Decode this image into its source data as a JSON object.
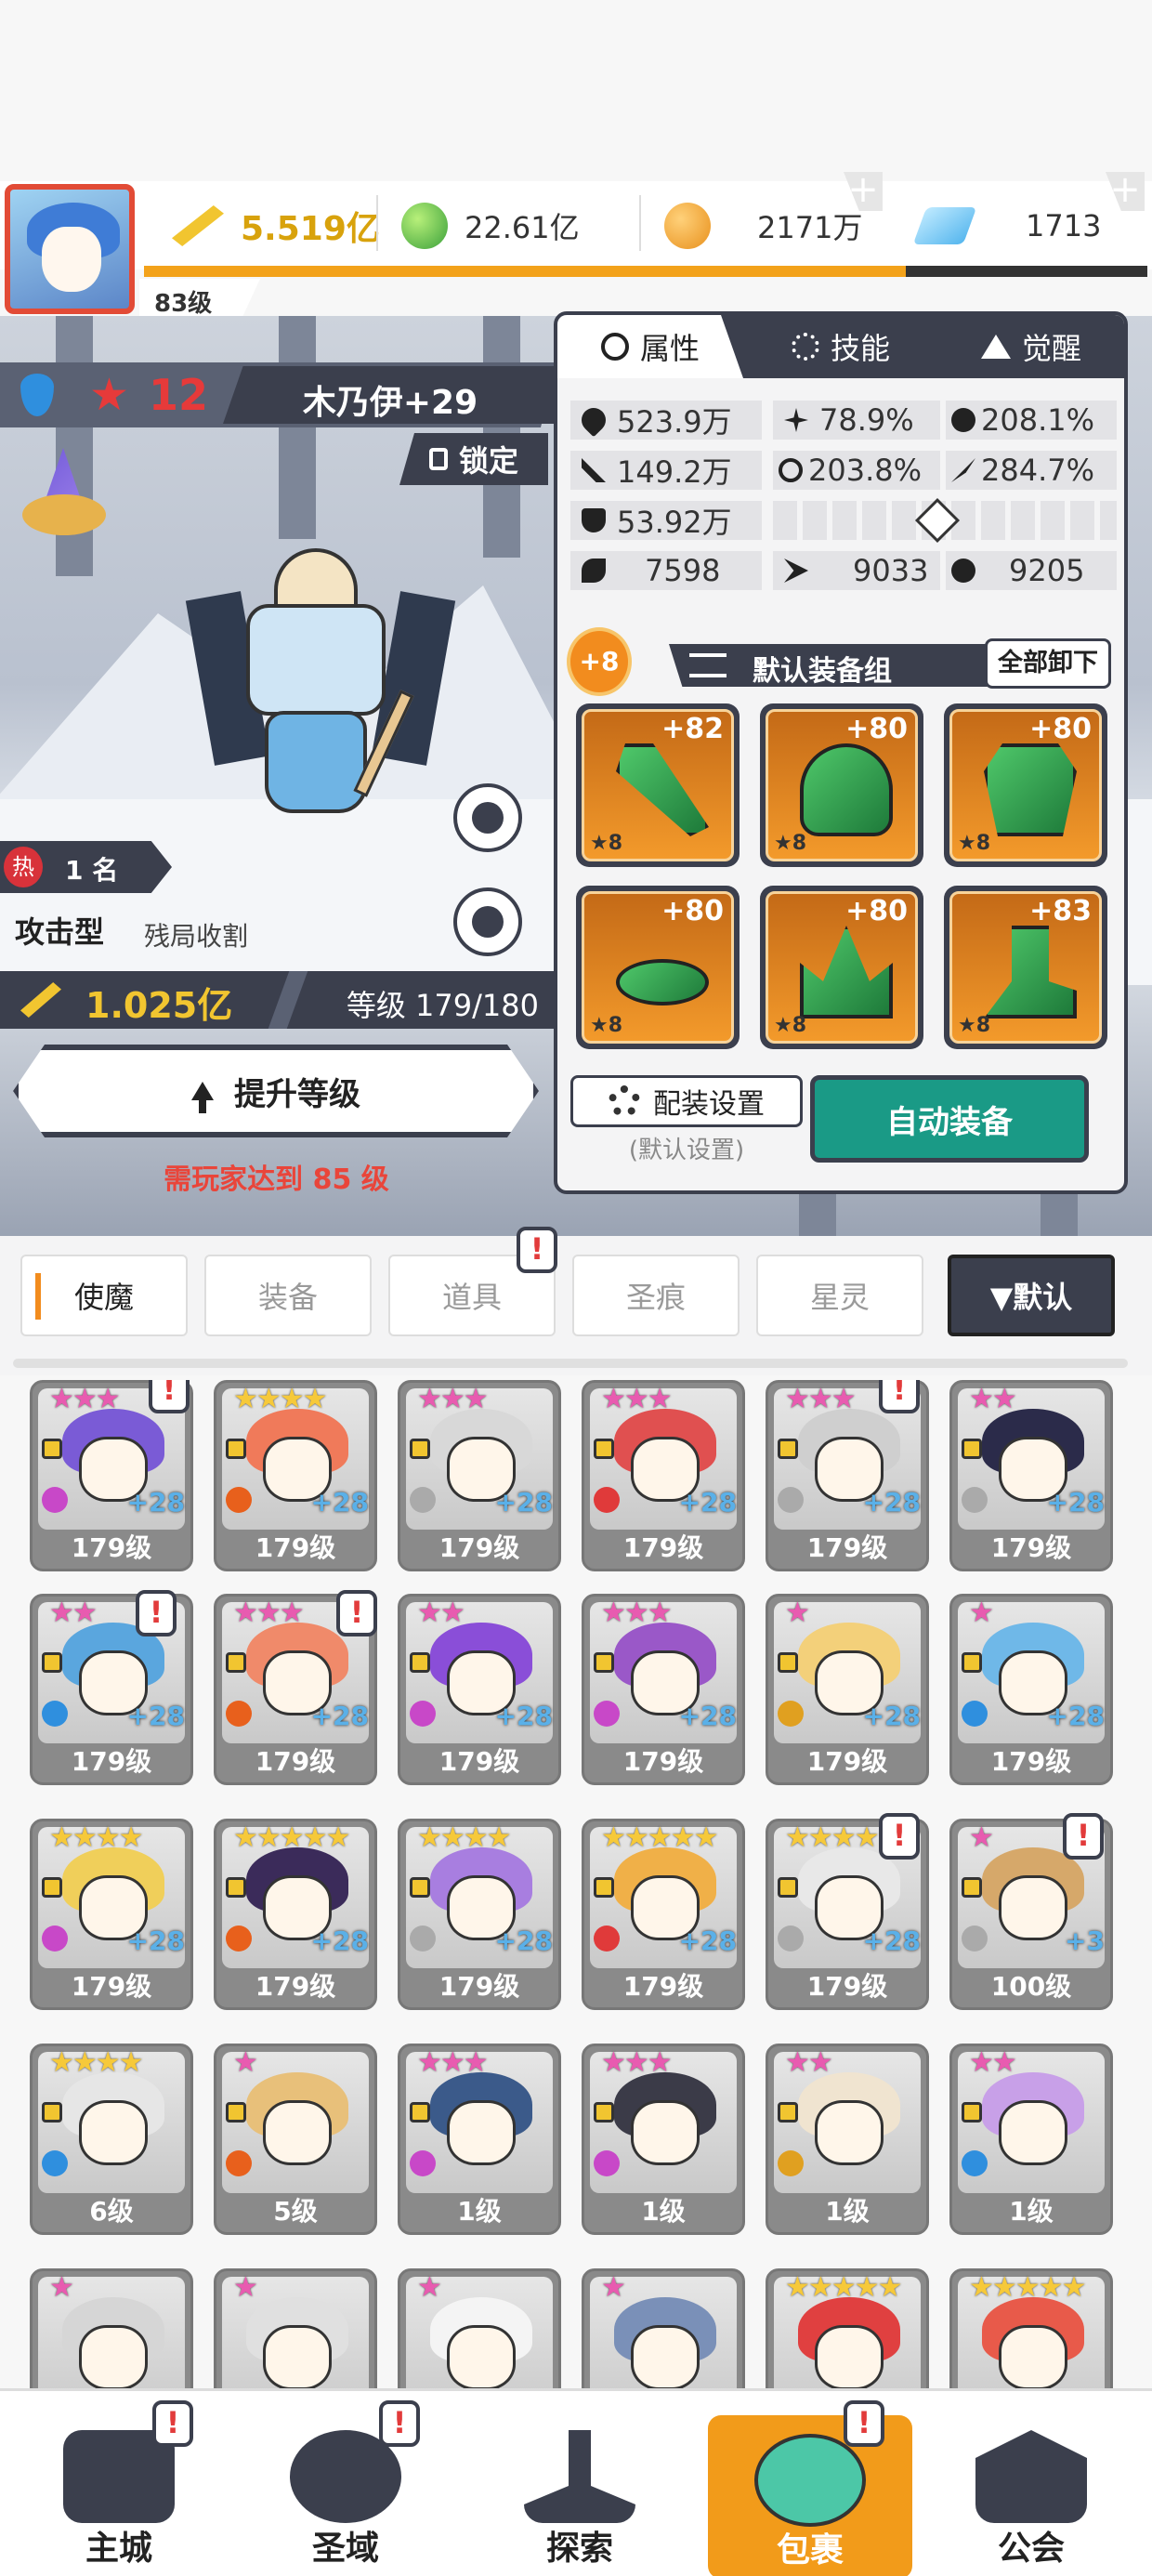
{
  "resources": {
    "power": "5.519亿",
    "gems": "22.61亿",
    "gold": "2171万",
    "crystal": "1713"
  },
  "player": {
    "level": "83级"
  },
  "hero": {
    "star_count": "12",
    "name": "木乃伊+29",
    "lock_label": "锁定",
    "rank": "1 名",
    "hot_label": "热",
    "type": "攻击型",
    "subtype": "残局收割",
    "power": "1.025亿",
    "level_text": "等级 179/180",
    "upgrade_label": "提升等级",
    "requirement": "需玩家达到 85 级"
  },
  "panel": {
    "tabs": [
      "属性",
      "技能",
      "觉醒"
    ],
    "stats": {
      "hp": "523.9万",
      "crit": "78.9%",
      "crit_dmg": "208.1%",
      "atk": "149.2万",
      "hit": "203.8%",
      "speed": "284.7%",
      "def": "53.92万",
      "s1": "7598",
      "s2": "9033",
      "s3": "9205"
    },
    "equip_plus": "+8",
    "equip_group": "默认装备组",
    "unload_all": "全部卸下",
    "gear": [
      {
        "plus": "+82",
        "star": "★8"
      },
      {
        "plus": "+80",
        "star": "★8"
      },
      {
        "plus": "+80",
        "star": "★8"
      },
      {
        "plus": "+80",
        "star": "★8"
      },
      {
        "plus": "+80",
        "star": "★8"
      },
      {
        "plus": "+83",
        "star": "★8"
      }
    ],
    "config_label": "配装设置",
    "config_sub": "(默认设置)",
    "auto_label": "自动装备"
  },
  "category_tabs": [
    "使魔",
    "装备",
    "道具",
    "圣痕",
    "星灵"
  ],
  "sort_label": "▼默认",
  "cards": [
    {
      "stars": "★★★",
      "plus": "+28",
      "lv": "179级"
    },
    {
      "stars": "★★★★",
      "plus": "+28",
      "lv": "179级"
    },
    {
      "stars": "★★★",
      "plus": "+28",
      "lv": "179级"
    },
    {
      "stars": "★★★",
      "plus": "+28",
      "lv": "179级"
    },
    {
      "stars": "★★★",
      "plus": "+28",
      "lv": "179级"
    },
    {
      "stars": "★★",
      "plus": "+28",
      "lv": "179级"
    },
    {
      "stars": "★★",
      "plus": "+28",
      "lv": "179级"
    },
    {
      "stars": "★★★",
      "plus": "+28",
      "lv": "179级"
    },
    {
      "stars": "★★",
      "plus": "+28",
      "lv": "179级"
    },
    {
      "stars": "★★★",
      "plus": "+28",
      "lv": "179级"
    },
    {
      "stars": "★",
      "plus": "+28",
      "lv": "179级"
    },
    {
      "stars": "★",
      "plus": "+28",
      "lv": "179级"
    },
    {
      "stars": "★★★★",
      "plus": "+28",
      "lv": "179级"
    },
    {
      "stars": "★★★★★",
      "plus": "+28",
      "lv": "179级"
    },
    {
      "stars": "★★★★",
      "plus": "+28",
      "lv": "179级"
    },
    {
      "stars": "★★★★★",
      "plus": "+28",
      "lv": "179级"
    },
    {
      "stars": "★★★★",
      "plus": "+28",
      "lv": "179级"
    },
    {
      "stars": "★",
      "plus": "+3",
      "lv": "100级"
    },
    {
      "stars": "★★★★",
      "plus": "",
      "lv": "6级"
    },
    {
      "stars": "★",
      "plus": "",
      "lv": "5级"
    },
    {
      "stars": "★★★",
      "plus": "",
      "lv": "1级"
    },
    {
      "stars": "★★★",
      "plus": "",
      "lv": "1级"
    },
    {
      "stars": "★★",
      "plus": "",
      "lv": "1级"
    },
    {
      "stars": "★★",
      "plus": "",
      "lv": "1级"
    },
    {
      "stars": "★",
      "plus": "",
      "lv": ""
    },
    {
      "stars": "★",
      "plus": "",
      "lv": ""
    },
    {
      "stars": "★",
      "plus": "",
      "lv": ""
    },
    {
      "stars": "★",
      "plus": "",
      "lv": ""
    },
    {
      "stars": "★★★★★",
      "plus": "",
      "lv": ""
    },
    {
      "stars": "★★★★★",
      "plus": "",
      "lv": ""
    }
  ],
  "nav": [
    "主城",
    "圣域",
    "探索",
    "包裹",
    "公会"
  ],
  "colors": {
    "accent_orange": "#f29b1a",
    "dark_panel": "#3b3f4d",
    "auto_button": "#1a9a86",
    "warning_red": "#e9453a",
    "power_gold": "#f1c530"
  },
  "icons": [
    "power-swords-icon",
    "green-gem-icon",
    "gold-coin-icon",
    "blue-crystal-icon",
    "water-element-icon",
    "star-icon",
    "lock-icon",
    "hat-icon",
    "hot-icon",
    "gear-settings-icon",
    "exclamation-icon"
  ]
}
